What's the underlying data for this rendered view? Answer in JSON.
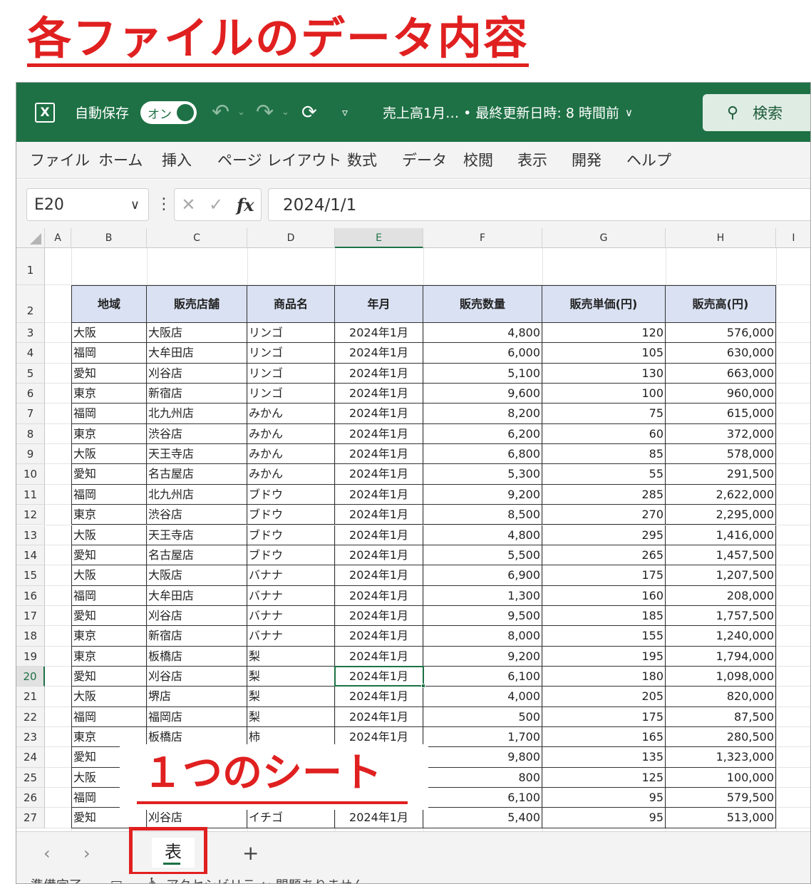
{
  "heading": "各ファイルのデータ内容",
  "titlebar": {
    "autosave_label": "自動保存",
    "toggle_label": "オン",
    "file_title": "売上高1月… • 最終更新日時: 8 時間前",
    "search_label": "検索"
  },
  "menu": [
    "ファイル",
    "ホーム",
    "挿入",
    "ページ レイアウト",
    "数式",
    "データ",
    "校閲",
    "表示",
    "開発",
    "ヘルプ"
  ],
  "formula": {
    "name_box": "E20",
    "value": "2024/1/1"
  },
  "columns": [
    "A",
    "B",
    "C",
    "D",
    "E",
    "F",
    "G",
    "H",
    "I"
  ],
  "rows": [
    "1",
    "2",
    "3",
    "4",
    "5",
    "6",
    "7",
    "8",
    "9",
    "10",
    "11",
    "12",
    "13",
    "14",
    "15",
    "16",
    "17",
    "18",
    "19",
    "20",
    "21",
    "22",
    "23",
    "24",
    "25",
    "26",
    "27"
  ],
  "table": {
    "headers": [
      "地域",
      "販売店舗",
      "商品名",
      "年月",
      "販売数量",
      "販売単価(円)",
      "販売高(円)"
    ],
    "rows": [
      [
        "大阪",
        "大阪店",
        "リンゴ",
        "2024年1月",
        "4,800",
        "120",
        "576,000"
      ],
      [
        "福岡",
        "大牟田店",
        "リンゴ",
        "2024年1月",
        "6,000",
        "105",
        "630,000"
      ],
      [
        "愛知",
        "刈谷店",
        "リンゴ",
        "2024年1月",
        "5,100",
        "130",
        "663,000"
      ],
      [
        "東京",
        "新宿店",
        "リンゴ",
        "2024年1月",
        "9,600",
        "100",
        "960,000"
      ],
      [
        "福岡",
        "北九州店",
        "みかん",
        "2024年1月",
        "8,200",
        "75",
        "615,000"
      ],
      [
        "東京",
        "渋谷店",
        "みかん",
        "2024年1月",
        "6,200",
        "60",
        "372,000"
      ],
      [
        "大阪",
        "天王寺店",
        "みかん",
        "2024年1月",
        "6,800",
        "85",
        "578,000"
      ],
      [
        "愛知",
        "名古屋店",
        "みかん",
        "2024年1月",
        "5,300",
        "55",
        "291,500"
      ],
      [
        "福岡",
        "北九州店",
        "ブドウ",
        "2024年1月",
        "9,200",
        "285",
        "2,622,000"
      ],
      [
        "東京",
        "渋谷店",
        "ブドウ",
        "2024年1月",
        "8,500",
        "270",
        "2,295,000"
      ],
      [
        "大阪",
        "天王寺店",
        "ブドウ",
        "2024年1月",
        "4,800",
        "295",
        "1,416,000"
      ],
      [
        "愛知",
        "名古屋店",
        "ブドウ",
        "2024年1月",
        "5,500",
        "265",
        "1,457,500"
      ],
      [
        "大阪",
        "大阪店",
        "バナナ",
        "2024年1月",
        "6,900",
        "175",
        "1,207,500"
      ],
      [
        "福岡",
        "大牟田店",
        "バナナ",
        "2024年1月",
        "1,300",
        "160",
        "208,000"
      ],
      [
        "愛知",
        "刈谷店",
        "バナナ",
        "2024年1月",
        "9,500",
        "185",
        "1,757,500"
      ],
      [
        "東京",
        "新宿店",
        "バナナ",
        "2024年1月",
        "8,000",
        "155",
        "1,240,000"
      ],
      [
        "東京",
        "板橋店",
        "梨",
        "2024年1月",
        "9,200",
        "195",
        "1,794,000"
      ],
      [
        "愛知",
        "刈谷店",
        "梨",
        "2024年1月",
        "6,100",
        "180",
        "1,098,000"
      ],
      [
        "大阪",
        "堺店",
        "梨",
        "2024年1月",
        "4,000",
        "205",
        "820,000"
      ],
      [
        "福岡",
        "福岡店",
        "梨",
        "2024年1月",
        "500",
        "175",
        "87,500"
      ],
      [
        "東京",
        "板橋店",
        "柿",
        "2024年1月",
        "1,700",
        "165",
        "280,500"
      ],
      [
        "愛知",
        "",
        "",
        "",
        "9,800",
        "135",
        "1,323,000"
      ],
      [
        "大阪",
        "",
        "",
        "",
        "800",
        "125",
        "100,000"
      ],
      [
        "福岡",
        "",
        "",
        "",
        "6,100",
        "95",
        "579,500"
      ],
      [
        "愛知",
        "刈谷店",
        "イチゴ",
        "2024年1月",
        "5,400",
        "95",
        "513,000"
      ]
    ]
  },
  "caption": "１つのシート",
  "sheet_tab": "表",
  "status": [
    "準備完了",
    "アクセシビリティ: 問題ありません"
  ]
}
